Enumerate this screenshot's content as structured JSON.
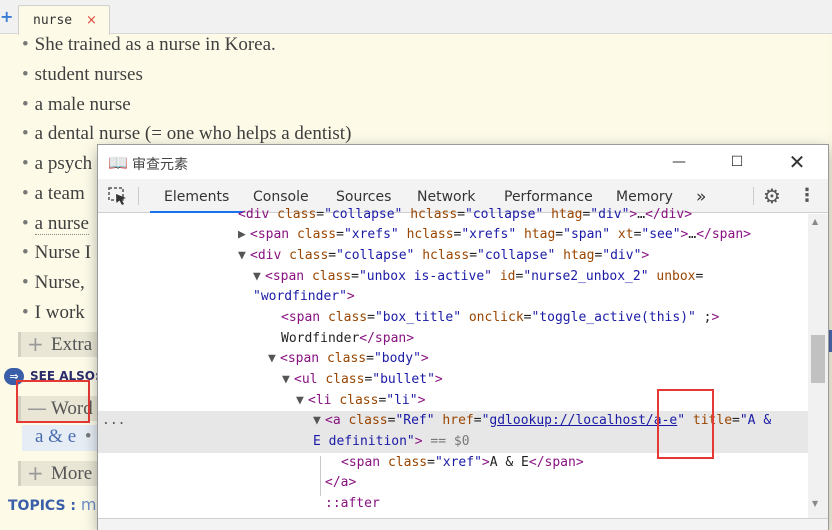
{
  "tabs": [
    {
      "label": "nurse",
      "close": "×"
    }
  ],
  "tab_add": "+",
  "entry": {
    "examples": [
      "She trained as a nurse in Korea.",
      "student nurses",
      "a male nurse",
      "a dental nurse (= one who helps a dentist)",
      "a psych",
      "a team",
      "a nurse",
      "Nurse I",
      "Nurse,",
      "I work"
    ],
    "extra_box_title": "Extra",
    "see_also_icon": "⇒",
    "see_also_label": "SEE ALSO:",
    "wordfinder_box_title": "Word",
    "wordfinder_link": "a & e",
    "wordfinder_sep": "•",
    "more_box_title": "More",
    "topics_label": "TOPICS :",
    "topics_value": "me",
    "box_plus": "+",
    "box_minus": "—"
  },
  "devtools": {
    "title_icon": "📖",
    "title": "审查元素",
    "minimize": "—",
    "maximize": "☐",
    "close": "✕",
    "tabs": [
      "Elements",
      "Console",
      "Sources",
      "Network",
      "Performance",
      "Memory"
    ],
    "more_tabs": "»",
    "settings_icon": "⚙",
    "kebab_icon": "⋮",
    "selected_dots": "...",
    "selected_suffix": "== $0"
  }
}
